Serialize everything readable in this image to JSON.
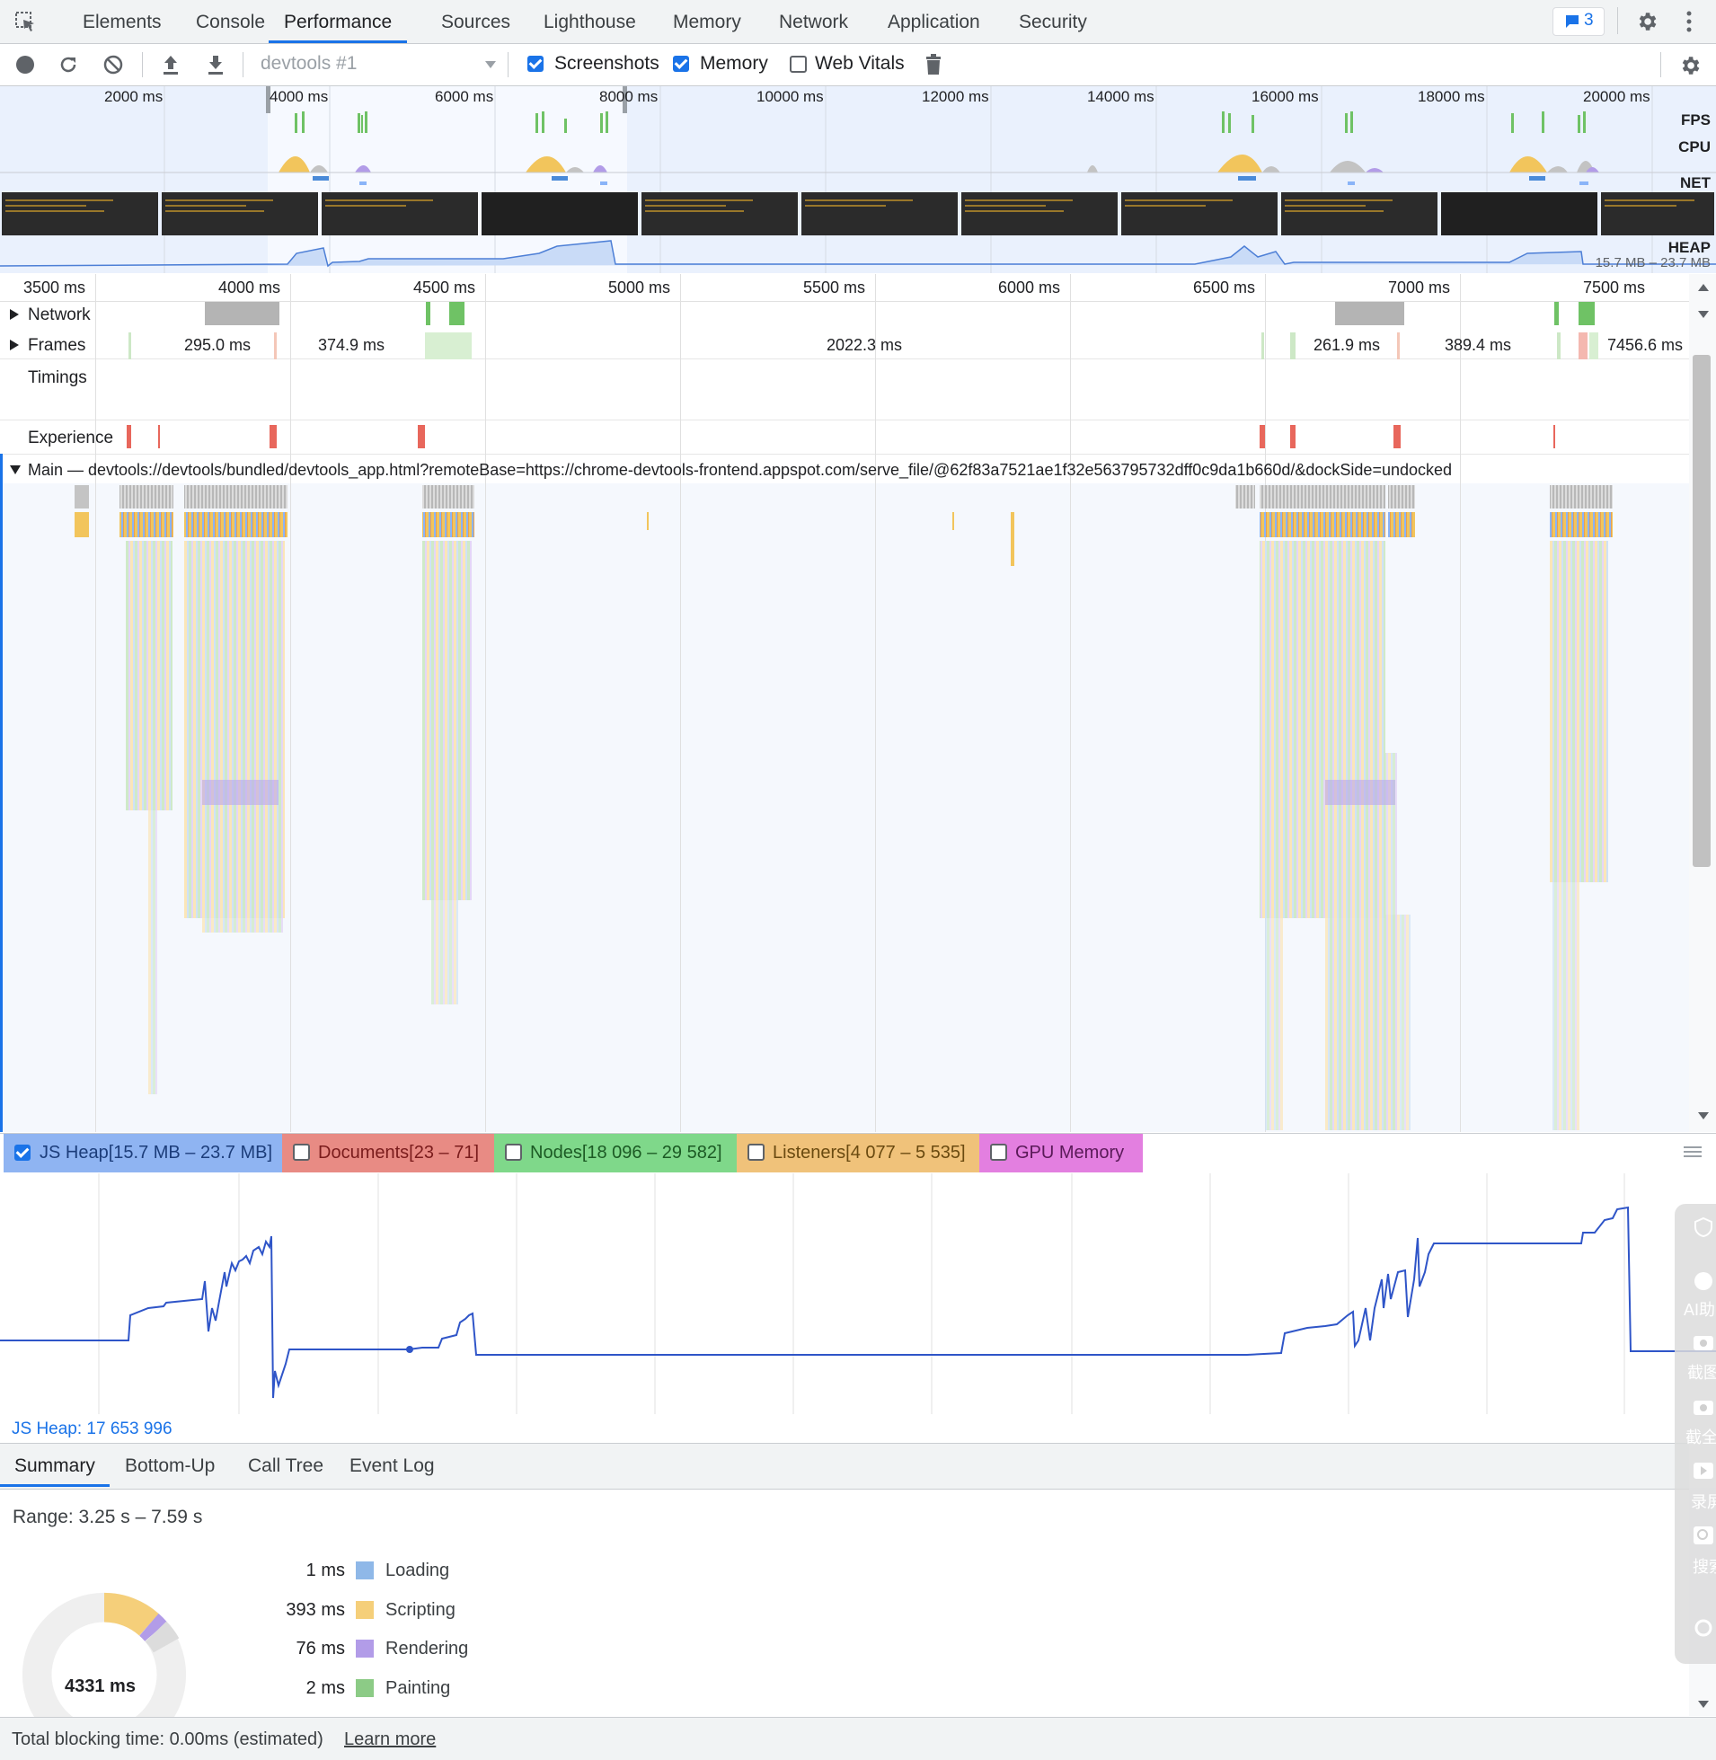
{
  "tabs": [
    "Elements",
    "Console",
    "Performance",
    "Sources",
    "Lighthouse",
    "Memory",
    "Network",
    "Application",
    "Security"
  ],
  "active_tab": "Performance",
  "issues_count": "3",
  "toolbar": {
    "profile_select": "devtools #1",
    "screenshots_label": "Screenshots",
    "memory_label": "Memory",
    "web_vitals_label": "Web Vitals",
    "screenshots_checked": true,
    "memory_checked": true,
    "web_vitals_checked": false
  },
  "overview": {
    "ticks": [
      "2000 ms",
      "4000 ms",
      "6000 ms",
      "8000 ms",
      "10000 ms",
      "12000 ms",
      "14000 ms",
      "16000 ms",
      "18000 ms",
      "20000 ms"
    ],
    "fps_label": "FPS",
    "cpu_label": "CPU",
    "net_label": "NET",
    "heap_label": "HEAP",
    "heap_range": "15.7 MB – 23.7 MB"
  },
  "timeline": {
    "ticks": [
      "3500 ms",
      "4000 ms",
      "4500 ms",
      "5000 ms",
      "5500 ms",
      "6000 ms",
      "6500 ms",
      "7000 ms",
      "7500 ms"
    ],
    "network_label": "Network",
    "frames_label": "Frames",
    "frame_times": [
      "295.0 ms",
      "374.9 ms",
      "2022.3 ms",
      "261.9 ms",
      "389.4 ms",
      "7456.6 ms"
    ],
    "timings_label": "Timings",
    "experience_label": "Experience",
    "main_label": "Main — devtools://devtools/bundled/devtools_app.html?remoteBase=https://chrome-devtools-frontend.appspot.com/serve_file/@62f83a7521ae1f32e563795732dff0c9da1b660d/&dockSide=undocked"
  },
  "counters": [
    {
      "label": "JS Heap[15.7 MB – 23.7 MB]",
      "checked": true,
      "color": "#8ab4f8"
    },
    {
      "label": "Documents[23 – 71]",
      "checked": false,
      "color": "#e88b84"
    },
    {
      "label": "Nodes[18 096 – 29 582]",
      "checked": false,
      "color": "#7fd88a"
    },
    {
      "label": "Listeners[4 077 – 5 535]",
      "checked": false,
      "color": "#f0c27a"
    },
    {
      "label": "GPU Memory",
      "checked": false,
      "color": "#e37fe0"
    }
  ],
  "js_heap_readout": "JS Heap: 17 653 996",
  "bottom_tabs": [
    "Summary",
    "Bottom-Up",
    "Call Tree",
    "Event Log"
  ],
  "active_bottom_tab": "Summary",
  "summary": {
    "range": "Range: 3.25 s – 7.59 s",
    "total": "4331 ms",
    "categories": [
      {
        "time": "1 ms",
        "name": "Loading",
        "color": "#8fb8e8"
      },
      {
        "time": "393 ms",
        "name": "Scripting",
        "color": "#f5cf7a"
      },
      {
        "time": "76 ms",
        "name": "Rendering",
        "color": "#b29ce8"
      },
      {
        "time": "2 ms",
        "name": "Painting",
        "color": "#8ccb86"
      }
    ]
  },
  "footer": {
    "blocking_text": "Total blocking time: 0.00ms (estimated)",
    "learn_more": "Learn more"
  },
  "side_panel": [
    "AI助",
    "截图",
    "截全",
    "录屏",
    "搜索"
  ],
  "colors": {
    "accent": "#1a73e8",
    "heap_line": "#2f55c8"
  }
}
